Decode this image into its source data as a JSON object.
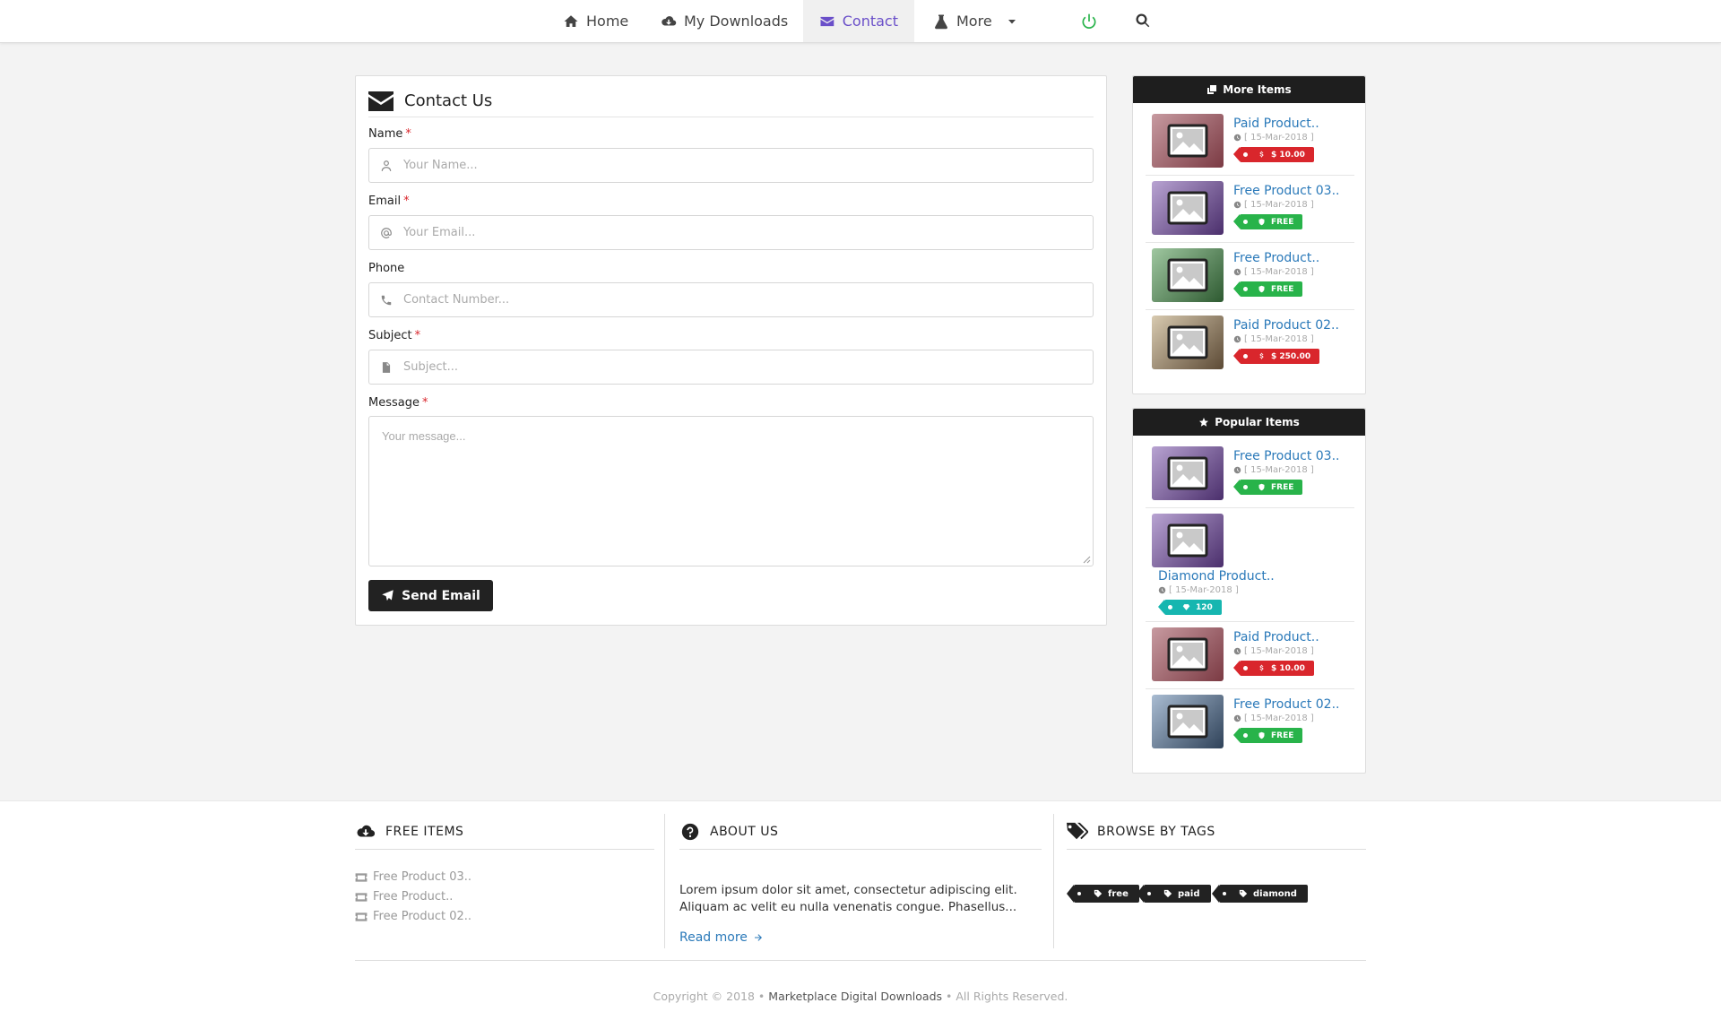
{
  "nav": {
    "home": "Home",
    "downloads": "My Downloads",
    "contact": "Contact",
    "more": "More"
  },
  "contact": {
    "title": "Contact Us",
    "name_label": "Name",
    "name_placeholder": "Your Name...",
    "email_label": "Email",
    "email_placeholder": "Your Email...",
    "phone_label": "Phone",
    "phone_placeholder": "Contact Number...",
    "subject_label": "Subject",
    "subject_placeholder": "Subject...",
    "message_label": "Message",
    "message_placeholder": "Your message...",
    "required_mark": "*",
    "send_label": "Send Email"
  },
  "more_items": {
    "title": "More Items",
    "items": [
      {
        "title": "Paid Product..",
        "date": "[ 15-Mar-2018 ]",
        "badge": "$ 10.00",
        "type": "paid"
      },
      {
        "title": "Free Product 03..",
        "date": "[ 15-Mar-2018 ]",
        "badge": "FREE",
        "type": "free"
      },
      {
        "title": "Free Product..",
        "date": "[ 15-Mar-2018 ]",
        "badge": "FREE",
        "type": "free"
      },
      {
        "title": "Paid Product 02..",
        "date": "[ 15-Mar-2018 ]",
        "badge": "$ 250.00",
        "type": "paid"
      }
    ]
  },
  "popular_items": {
    "title": "Popular Items",
    "items": [
      {
        "title": "Free Product 03..",
        "date": "[ 15-Mar-2018 ]",
        "badge": "FREE",
        "type": "free"
      },
      {
        "title": "Diamond Product..",
        "date": "[ 15-Mar-2018 ]",
        "badge": "120",
        "type": "diamond"
      },
      {
        "title": "Paid Product..",
        "date": "[ 15-Mar-2018 ]",
        "badge": "$ 10.00",
        "type": "paid"
      },
      {
        "title": "Free Product 02..",
        "date": "[ 15-Mar-2018 ]",
        "badge": "FREE",
        "type": "free"
      }
    ]
  },
  "footer": {
    "free_items_title": "FREE ITEMS",
    "free_items": [
      "Free Product 03..",
      "Free Product..",
      "Free Product 02.."
    ],
    "about_title": "ABOUT US",
    "about_text": "Lorem ipsum dolor sit amet, consectetur adipiscing elit. Aliquam ac velit eu nulla venenatis congue. Phasellus...",
    "read_more": "Read more",
    "tags_title": "BROWSE BY TAGS",
    "tags": [
      "free",
      "paid",
      "diamond"
    ],
    "copyright_prefix": "Copyright © 2018 •",
    "brand": "Marketplace Digital Downloads",
    "copyright_suffix": "• All Rights Reserved."
  },
  "colors": {
    "accent": "#6a4fc9",
    "link": "#2a79b9",
    "paid": "#d9262c",
    "free": "#28b34a",
    "diamond": "#16b6b0",
    "power": "#28b34a"
  },
  "icons": [
    "home-icon",
    "cloud-download-icon",
    "envelope-icon",
    "flask-icon",
    "caret-down-icon",
    "power-icon",
    "search-icon",
    "user-icon",
    "at-icon",
    "phone-icon",
    "file-icon",
    "paper-plane-icon",
    "clone-icon",
    "star-icon",
    "image-icon",
    "clock-icon",
    "dollar-icon",
    "shield-icon",
    "diamond-icon",
    "question-circle-icon",
    "tags-icon",
    "tag-icon",
    "ticket-icon",
    "arrow-right-icon"
  ]
}
